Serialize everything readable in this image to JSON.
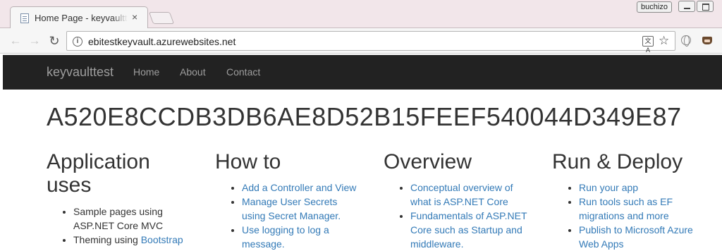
{
  "browser": {
    "tab_title": "Home Page - keyvaulttest",
    "close_glyph": "×",
    "profile_name": "buchizo",
    "url": "ebitestkeyvault.azurewebsites.net",
    "back_glyph": "←",
    "forward_glyph": "→",
    "reload_glyph": "↻",
    "info_glyph": "i",
    "translate_glyph": "文A",
    "star_glyph": "☆"
  },
  "site": {
    "brand": "keyvaulttest",
    "nav": [
      "Home",
      "About",
      "Contact"
    ],
    "secret_hash": "A520E8CCDB3DB6AE8D52B15FEEF540044D349E87",
    "columns": [
      {
        "heading": "Application uses",
        "items": [
          {
            "text": "Sample pages using ASP.NET Core MVC"
          },
          {
            "prefix": "Theming using ",
            "link": "Bootstrap"
          }
        ]
      },
      {
        "heading": "How to",
        "items": [
          "Add a Controller and View",
          "Manage User Secrets using Secret Manager.",
          "Use logging to log a message."
        ]
      },
      {
        "heading": "Overview",
        "items": [
          "Conceptual overview of what is ASP.NET Core",
          "Fundamentals of ASP.NET Core such as Startup and middleware."
        ]
      },
      {
        "heading": "Run & Deploy",
        "items": [
          "Run your app",
          "Run tools such as EF migrations and more",
          "Publish to Microsoft Azure Web Apps"
        ]
      }
    ]
  },
  "colors": {
    "navbar_bg": "#222222",
    "nav_text": "#9d9d9d",
    "link": "#337ab7",
    "tabstrip_bg": "#f2e6ea"
  }
}
